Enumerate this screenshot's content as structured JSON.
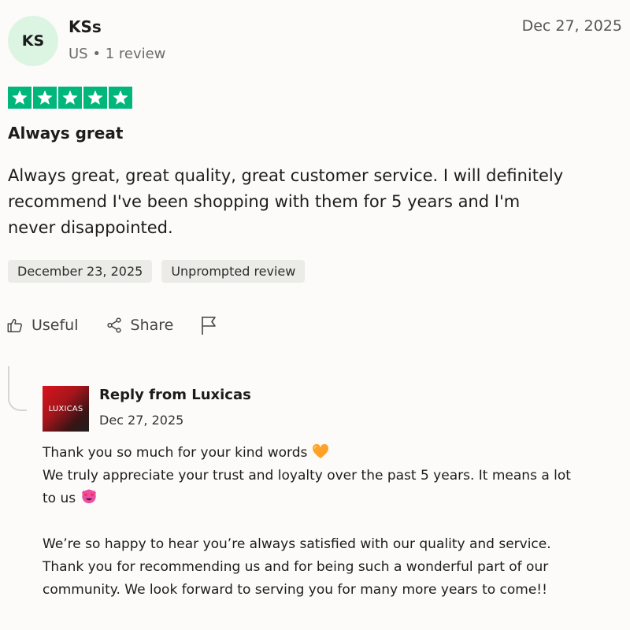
{
  "reviewer": {
    "initials": "KS",
    "name": "KSs",
    "country": "US",
    "separator": "•",
    "review_count": "1 review"
  },
  "review": {
    "date": "Dec 27, 2025",
    "rating": 5,
    "rating_max": 5,
    "star_color": "#00b67a",
    "title": "Always great",
    "body_lines": [
      "Always great, great quality, great customer service. I will definitely",
      "recommend I've been shopping with them for 5 years and I'm",
      "never disappointed."
    ],
    "experience_date": "December 23, 2025",
    "tag": "Unprompted review"
  },
  "actions": {
    "useful_label": "Useful",
    "share_label": "Share",
    "useful_icon": "thumbs-up-icon",
    "share_icon": "share-icon",
    "report_icon": "flag-icon"
  },
  "reply": {
    "logo_text": "LUXICAS",
    "title": "Reply from Luxicas",
    "date": "Dec 27, 2025",
    "line1": "Thank you so much for your kind words",
    "line1_emoji": "orange-heart-emoji",
    "line2": "We truly appreciate your trust and loyalty over the past 5 years. It means a lot",
    "line3": "to us",
    "line3_emoji": "heart-eyes-emoji",
    "line4": "We’re so happy to hear you’re always satisfied with our quality and service.",
    "line5": "Thank you for recommending us and for being such a wonderful part of our",
    "line6": "community. We look forward to serving you for many more years to come!!"
  }
}
